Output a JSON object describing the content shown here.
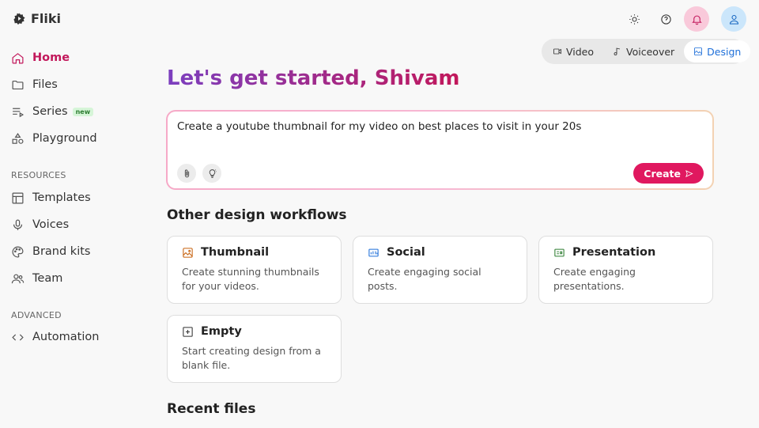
{
  "app": {
    "name": "Fliki"
  },
  "sidebar": {
    "items": [
      {
        "label": "Home",
        "icon": "home-icon"
      },
      {
        "label": "Files",
        "icon": "folder-icon"
      },
      {
        "label": "Series",
        "icon": "playlist-icon",
        "badge": "new"
      },
      {
        "label": "Playground",
        "icon": "shapes-icon"
      }
    ],
    "resources_label": "RESOURCES",
    "resources": [
      {
        "label": "Templates",
        "icon": "layout-icon"
      },
      {
        "label": "Voices",
        "icon": "microphone-icon"
      },
      {
        "label": "Brand kits",
        "icon": "palette-icon"
      },
      {
        "label": "Team",
        "icon": "team-icon"
      }
    ],
    "advanced_label": "ADVANCED",
    "advanced": [
      {
        "label": "Automation",
        "icon": "code-icon"
      }
    ]
  },
  "mode_tabs": [
    {
      "label": "Video",
      "icon": "video-icon"
    },
    {
      "label": "Voiceover",
      "icon": "music-note-icon"
    },
    {
      "label": "Design",
      "icon": "image-icon",
      "active": true
    }
  ],
  "main": {
    "headline": "Let's get started, Shivam",
    "prompt_text": "Create a youtube thumbnail for my video on best places to visit in your 20s",
    "create_label": "Create",
    "workflows_title": "Other design workflows",
    "workflows": [
      {
        "title": "Thumbnail",
        "desc": "Create stunning thumbnails for your videos.",
        "icon": "thumbnail-icon",
        "color": "#c7620f"
      },
      {
        "title": "Social",
        "desc": "Create engaging social posts.",
        "icon": "social-icon",
        "color": "#1e6fd9"
      },
      {
        "title": "Presentation",
        "desc": "Create engaging presentations.",
        "icon": "presentation-icon",
        "color": "#2e7d32"
      },
      {
        "title": "Empty",
        "desc": "Start creating design from a blank file.",
        "icon": "plus-square-icon",
        "color": "#333333"
      }
    ],
    "recent_title": "Recent files"
  },
  "colors": {
    "accent": "#e0185f",
    "active_nav": "#c2185b",
    "design_tab": "#1e6fd9"
  }
}
